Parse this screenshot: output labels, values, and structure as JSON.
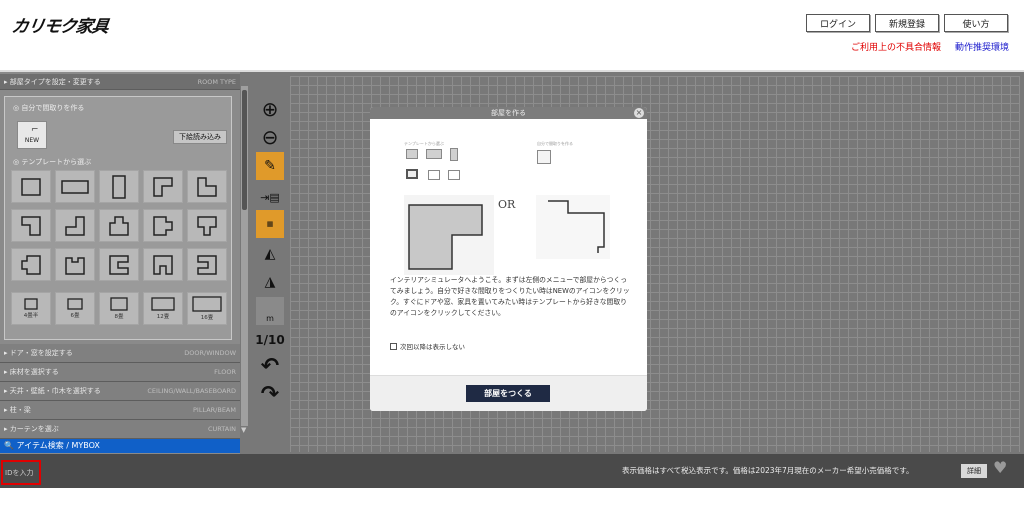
{
  "header": {
    "logo_text": "カリモク家具",
    "buttons": [
      "ログイン",
      "新規登録",
      "使い方"
    ],
    "links": {
      "bug_info": "ご利用上の不具合情報",
      "env": "動作推奨環境"
    },
    "link_colors": {
      "bug_info": "#e00000",
      "env": "#1a1acc"
    }
  },
  "sidebar": {
    "room_type": {
      "label": "部屋タイプを設定・変更する",
      "en": "ROOM TYPE"
    },
    "self_make_label": "自分で間取りを作る",
    "new_label": "NEW",
    "trace_label": "下絵読み込み",
    "template_label": "テンプレートから選ぶ",
    "sizes": [
      "4畳半",
      "6畳",
      "8畳",
      "12畳",
      "16畳"
    ],
    "sections": [
      {
        "label": "ドア・窓を設定する",
        "en": "DOOR/WINDOW"
      },
      {
        "label": "床材を選択する",
        "en": "FLOOR"
      },
      {
        "label": "天井・壁紙・巾木を選択する",
        "en": "CEILING/WALL/BASEBOARD"
      },
      {
        "label": "柱・梁",
        "en": "PILLAR/BEAM"
      },
      {
        "label": "カーテンを選ぶ",
        "en": "CURTAIN"
      }
    ],
    "search_label": "アイテム検索 / MYBOX"
  },
  "toolbar": {
    "tools": [
      "zoom-in-icon",
      "zoom-out-icon",
      "pencil-icon",
      "measure-icon",
      "room-size-icon",
      "mirror-vertical-icon",
      "mirror-horizontal-icon",
      "grid-m-icon",
      "scale-icon",
      "undo-icon",
      "redo-icon"
    ],
    "scale_text": "1/10",
    "grid_label": "m"
  },
  "modal": {
    "title": "部屋を作る",
    "template_caption": "テンプレートから選ぶ",
    "self_caption": "自分で間取りを作る",
    "or_text": "OR",
    "description": "インテリアシミュレータへようこそ。まずは左側のメニューで部屋からつくってみましょう。自分で好きな間取りをつくりたい時はNEWのアイコンをクリック。すぐにドアや窓、家具を置いてみたい時はテンプレートから好きな間取りのアイコンをクリックしてください。",
    "checkbox_label": "次回以降は表示しない",
    "checkbox_checked": false,
    "create_button": "部屋をつくる"
  },
  "footer": {
    "id_input_placeholder": "IDを入力",
    "notice": "表示価格はすべて税込表示です。価格は2023年7月現在のメーカー希望小売価格です。",
    "detail_button": "詳細"
  },
  "colors": {
    "accent_orange": "#e09a2a",
    "search_blue": "#1060c8",
    "modal_button": "#1f2a44",
    "highlight_red": "#e00000"
  }
}
